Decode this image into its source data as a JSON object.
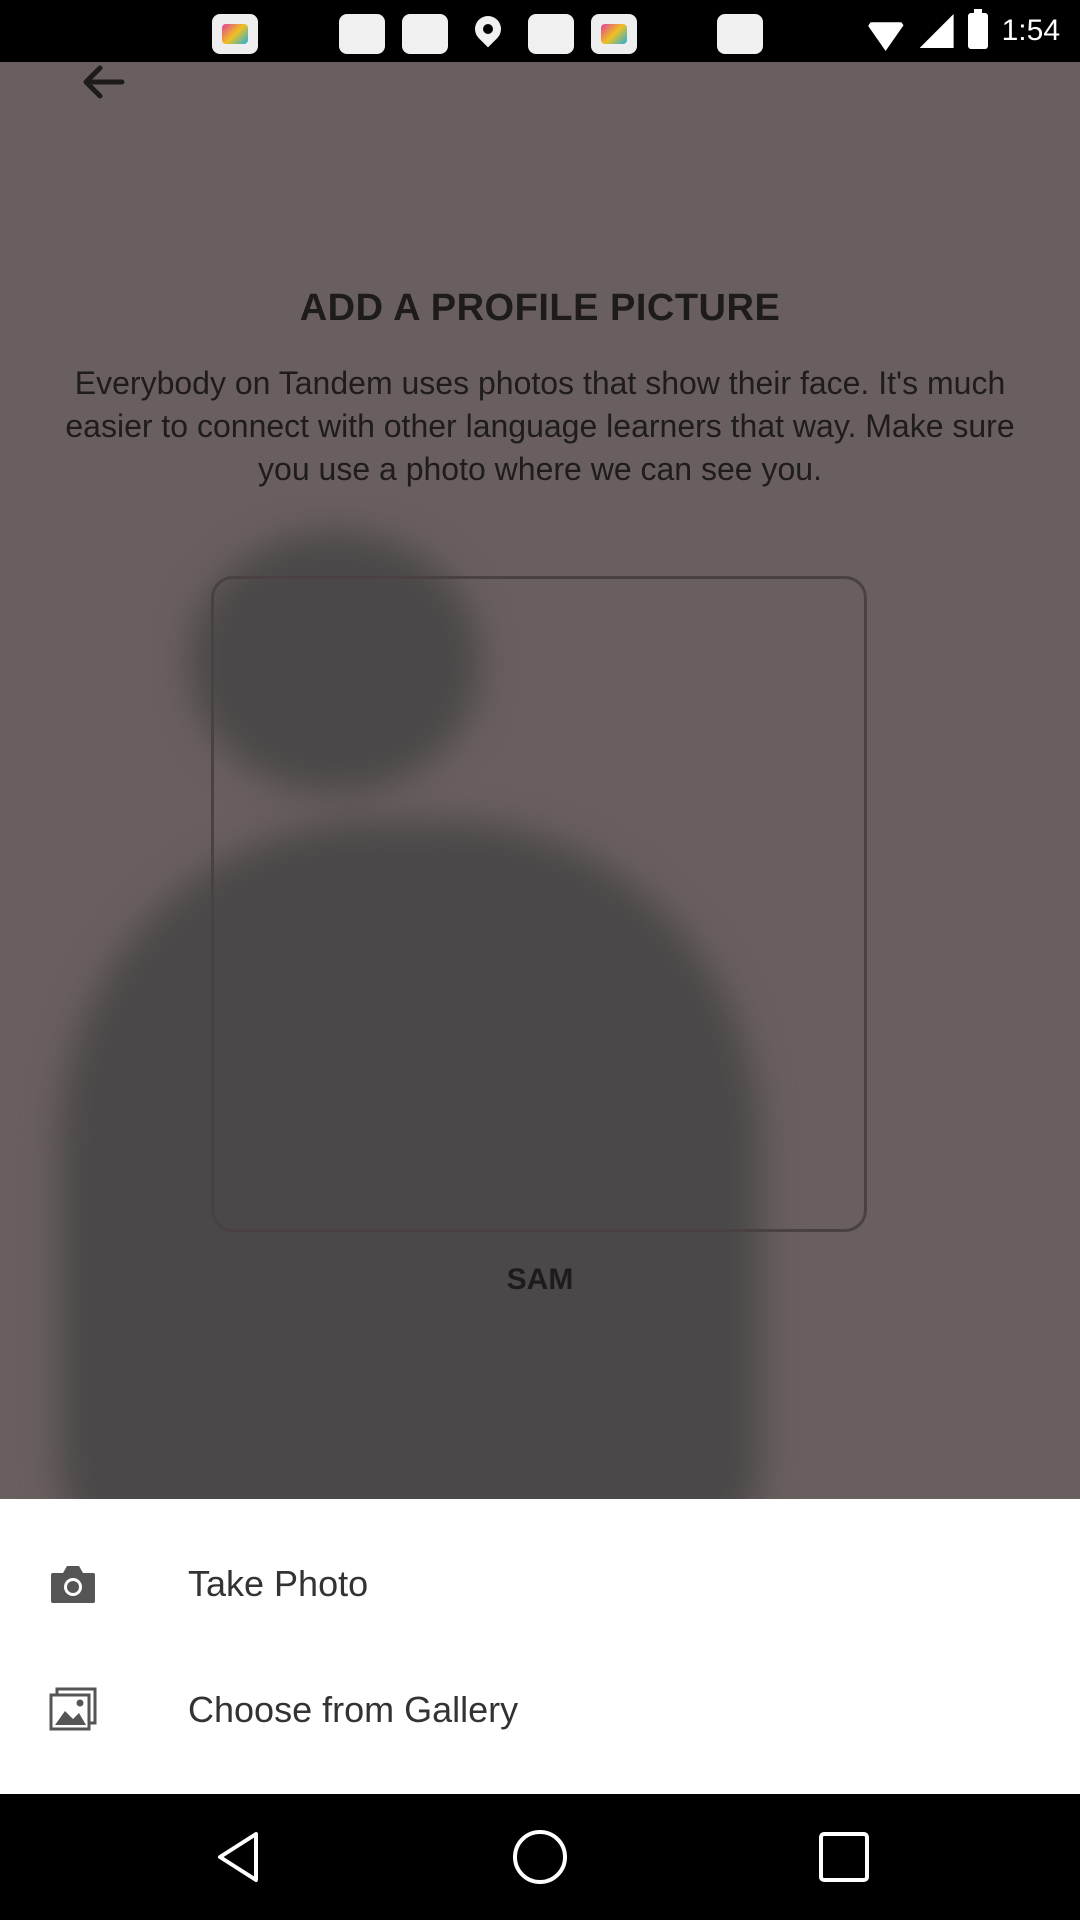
{
  "status_bar": {
    "time": "1:54",
    "notifications": [
      "pop-notification-icon",
      "gallery-notification-icon",
      "gallery-notification-icon",
      "location-icon",
      "gallery-notification-icon",
      "pop-notification-icon",
      "gallery-notification-icon"
    ]
  },
  "screen": {
    "title": "ADD A PROFILE PICTURE",
    "description": "Everybody on Tandem uses photos that show their face. It's much easier to connect with other language learners that way. Make sure you use a photo where we can see you.",
    "name": "SAM"
  },
  "sheet": {
    "items": [
      {
        "label": "Take Photo",
        "icon": "camera-icon"
      },
      {
        "label": "Choose from Gallery",
        "icon": "gallery-icon"
      }
    ]
  },
  "nav": {
    "buttons": [
      "back-triangle-icon",
      "home-circle-icon",
      "recents-square-icon"
    ]
  },
  "colors": {
    "overlay": "#6a5f5f",
    "sheet": "#ffffff",
    "text_dark": "#1e1b1b"
  }
}
